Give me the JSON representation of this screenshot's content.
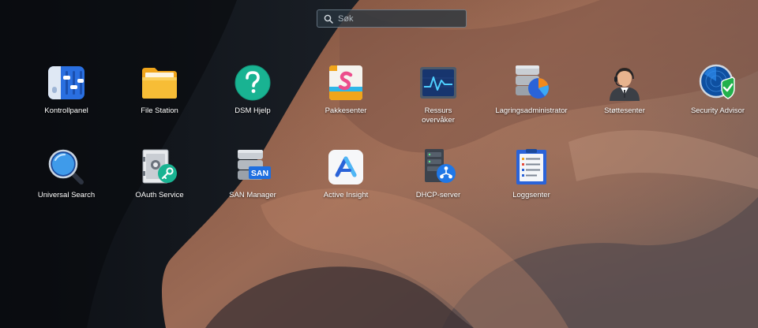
{
  "search": {
    "placeholder": "Søk"
  },
  "apps": [
    {
      "label": "Kontrollpanel",
      "icon": "control-panel-icon"
    },
    {
      "label": "File Station",
      "icon": "folder-icon"
    },
    {
      "label": "DSM Hjelp",
      "icon": "help-icon"
    },
    {
      "label": "Pakkesenter",
      "icon": "package-center-icon"
    },
    {
      "label": "Ressurs\novervåker",
      "icon": "resource-monitor-icon"
    },
    {
      "label": "Lagringsadministrator",
      "icon": "storage-manager-icon"
    },
    {
      "label": "Støttesenter",
      "icon": "support-center-icon"
    },
    {
      "label": "Security Advisor",
      "icon": "security-advisor-icon"
    },
    {
      "label": "Universal Search",
      "icon": "universal-search-icon"
    },
    {
      "label": "OAuth Service",
      "icon": "oauth-service-icon"
    },
    {
      "label": "SAN Manager",
      "icon": "san-manager-icon"
    },
    {
      "label": "Active Insight",
      "icon": "active-insight-icon"
    },
    {
      "label": "DHCP-server",
      "icon": "dhcp-server-icon"
    },
    {
      "label": "Loggsenter",
      "icon": "log-center-icon"
    }
  ],
  "icon_text": {
    "san": "SAN"
  }
}
